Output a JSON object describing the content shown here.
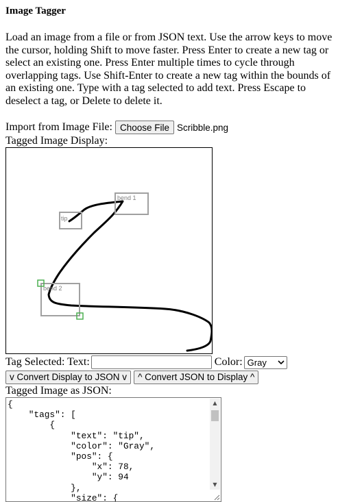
{
  "app": {
    "title": "Image Tagger",
    "description": "Load an image from a file or from JSON text. Use the arrow keys to move the cursor, holding Shift to move faster. Press Enter to create a new tag or select an existing one. Press Enter multiple times to cycle through overlapping tags. Use Shift-Enter to create a new tag within the bounds of an existing one. Type with a tag selected to add text. Press Escape to deselect a tag, or Delete to delete it."
  },
  "import": {
    "label": "Import from Image File:",
    "button_label": "Choose File",
    "file_name": "Scribble.png"
  },
  "display": {
    "label": "Tagged Image Display:",
    "tags": [
      {
        "text": "tip"
      },
      {
        "text": "bend 1"
      },
      {
        "text": "bend 2"
      }
    ]
  },
  "tag_editor": {
    "selected_label": "Tag Selected: Text:",
    "text_value": "",
    "color_label": "Color:",
    "color_value": "Gray"
  },
  "buttons": {
    "to_json": "v Convert Display to JSON v",
    "to_display": "^ Convert JSON to Display ^"
  },
  "json": {
    "label": "Tagged Image as JSON:",
    "text": "{\n    \"tags\": [\n        {\n            \"text\": \"tip\",\n            \"color\": \"Gray\",\n            \"pos\": {\n                \"x\": 78,\n                \"y\": 94\n            },\n            \"size\": {"
  },
  "colors": {
    "tag_box": "#a0a0a0",
    "handle": "#4caf50",
    "stroke": "#000000"
  },
  "icons": {
    "select_arrow": "chevron-down-icon",
    "scroll_up": "triangle-up-icon",
    "scroll_down": "triangle-down-icon"
  }
}
